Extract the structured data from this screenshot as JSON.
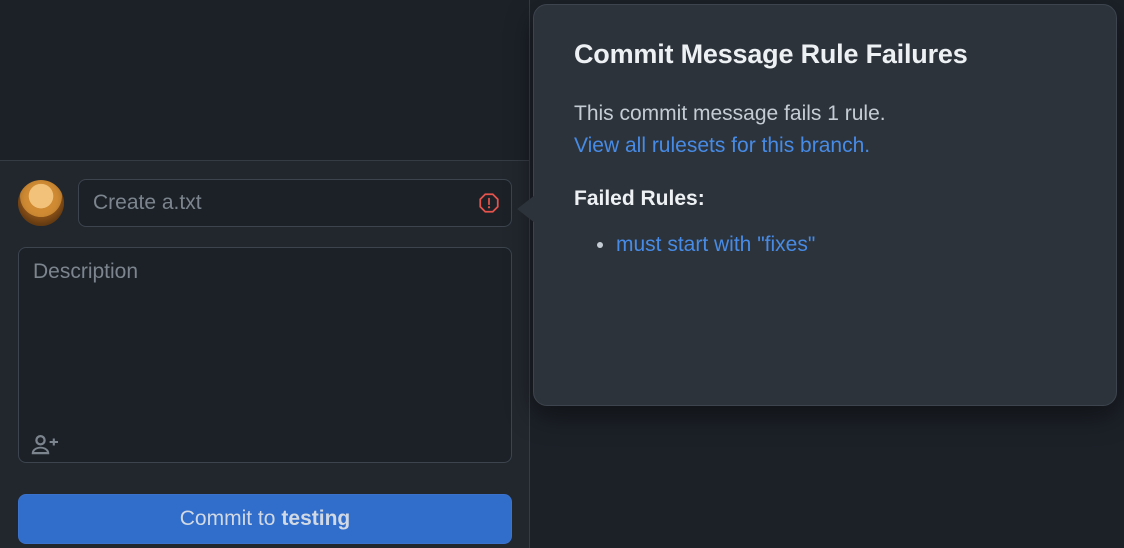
{
  "commit": {
    "summary_placeholder": "Create a.txt",
    "summary_value": "",
    "description_placeholder": "Description",
    "description_value": "",
    "button_prefix": "Commit to ",
    "branch": "testing"
  },
  "popover": {
    "title": "Commit Message Rule Failures",
    "body": "This commit message fails 1 rule.",
    "view_link": "View all rulesets for this branch.",
    "failed_heading": "Failed Rules:",
    "rules": [
      {
        "label": "must start with \"fixes\""
      }
    ]
  },
  "icons": {
    "alert": "alert-icon",
    "add_coauthor": "person-add-icon"
  }
}
